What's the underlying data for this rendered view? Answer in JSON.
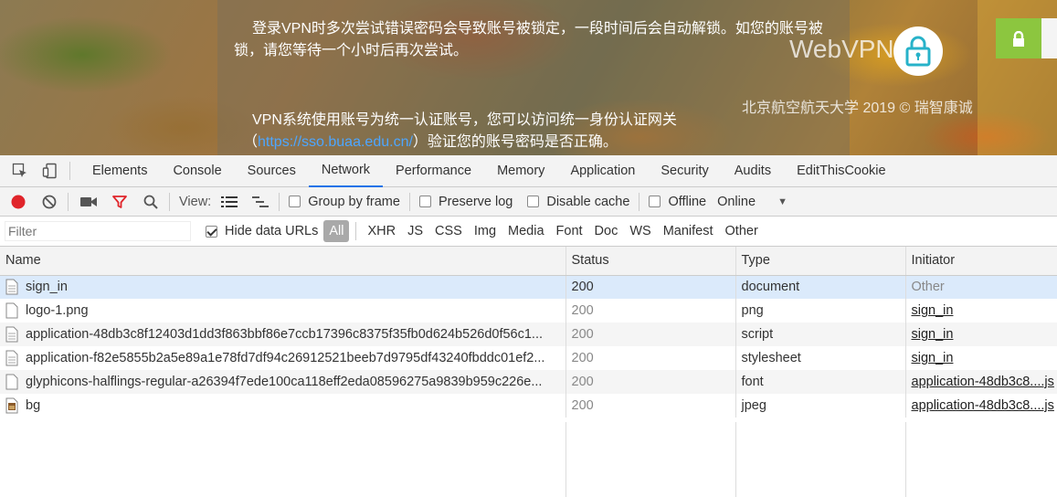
{
  "page": {
    "notice1": "登录VPN时多次尝试错误密码会导致账号被锁定，一段时间后会自动解锁。如您的账号被锁，请您等待一个小时后再次尝试。",
    "notice2_prefix": "VPN系统使用账号为统一认证账号，您可以访问统一身份认证网关（",
    "notice2_link": "https://sso.buaa.edu.cn/",
    "notice2_suffix": "）验证您的账号密码是否正确。",
    "brand": "WebVPN",
    "copyright": "北京航空航天大学 2019 © 瑞智康诚"
  },
  "devtools": {
    "tabs": [
      "Elements",
      "Console",
      "Sources",
      "Network",
      "Performance",
      "Memory",
      "Application",
      "Security",
      "Audits",
      "EditThisCookie"
    ],
    "active_tab": "Network",
    "toolbar": {
      "view_label": "View:",
      "group_by_frame": "Group by frame",
      "preserve_log": "Preserve log",
      "disable_cache": "Disable cache",
      "offline": "Offline",
      "throttle": "Online"
    },
    "filter": {
      "placeholder": "Filter",
      "hide_data_urls": "Hide data URLs",
      "types": [
        "All",
        "XHR",
        "JS",
        "CSS",
        "Img",
        "Media",
        "Font",
        "Doc",
        "WS",
        "Manifest",
        "Other"
      ],
      "active_type": "All"
    },
    "columns": [
      "Name",
      "Status",
      "Type",
      "Initiator"
    ],
    "requests": [
      {
        "name": "sign_in",
        "status": "200",
        "type": "document",
        "initiator": "Other",
        "icon": "document-icon"
      },
      {
        "name": "logo-1.png",
        "status": "200",
        "type": "png",
        "initiator": "sign_in",
        "icon": "image-file-icon"
      },
      {
        "name": "application-48db3c8f12403d1dd3f863bbf86e7ccb17396c8375f35fb0d624b526d0f56c1...",
        "status": "200",
        "type": "script",
        "initiator": "sign_in",
        "icon": "script-file-icon"
      },
      {
        "name": "application-f82e5855b2a5e89a1e78fd7df94c26912521beeb7d9795df43240fbddc01ef2...",
        "status": "200",
        "type": "stylesheet",
        "initiator": "sign_in",
        "icon": "stylesheet-file-icon"
      },
      {
        "name": "glyphicons-halflings-regular-a26394f7ede100ca118eff2eda08596275a9839b959c226e...",
        "status": "200",
        "type": "font",
        "initiator": "application-48db3c8....js",
        "icon": "font-file-icon"
      },
      {
        "name": "bg",
        "status": "200",
        "type": "jpeg",
        "initiator": "application-48db3c8....js",
        "icon": "jpeg-image-icon"
      }
    ]
  }
}
